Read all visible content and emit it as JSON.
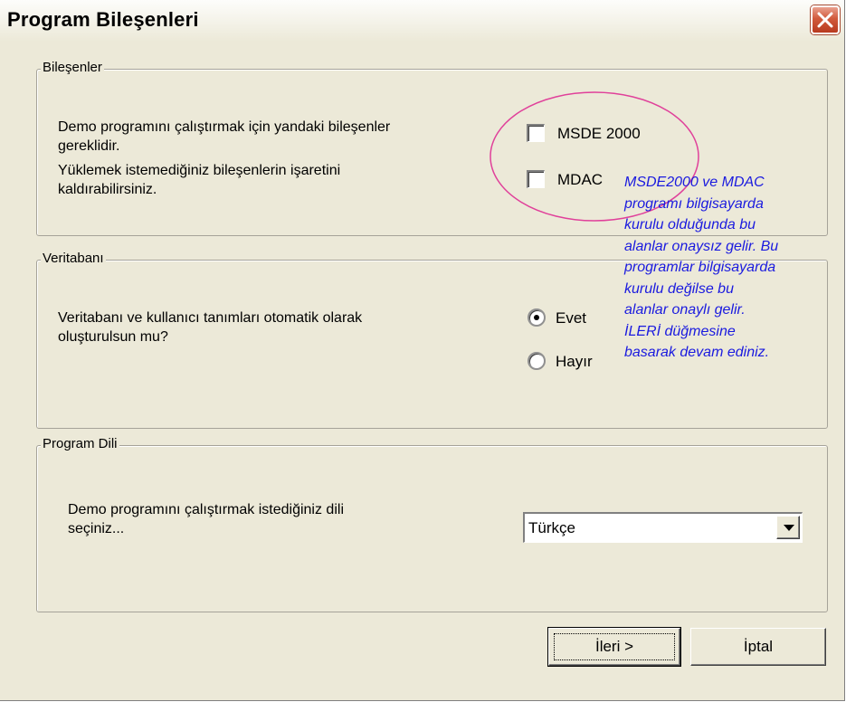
{
  "window": {
    "title": "Program Bileşenleri"
  },
  "components": {
    "legend": "Bileşenler",
    "description_line1": "Demo programını çalıştırmak için yandaki bileşenler",
    "description_line2": "gereklidir.",
    "description_line3": "Yüklemek istemediğiniz bileşenlerin işaretini",
    "description_line4": "kaldırabilirsiniz.",
    "options": [
      {
        "label": "MSDE 2000",
        "checked": false
      },
      {
        "label": "MDAC",
        "checked": false
      }
    ]
  },
  "database": {
    "legend": "Veritabanı",
    "description_line1": "Veritabanı ve kullanıcı tanımları otomatik olarak",
    "description_line2": "oluşturulsun mu?",
    "options": [
      {
        "label": "Evet",
        "selected": true
      },
      {
        "label": "Hayır",
        "selected": false
      }
    ]
  },
  "language": {
    "legend": "Program Dili",
    "description_line1": "Demo programını çalıştırmak istediğiniz dili",
    "description_line2": "seçiniz...",
    "selected": "Türkçe"
  },
  "annotation": {
    "text": "MSDE2000 ve MDAC\nprogramı bilgisayarda\nkurulu olduğunda bu\nalanlar onaysız gelir. Bu\nprogramlar bilgisayarda\nkurulu değilse bu\nalanlar onaylı gelir.\nİLERİ düğmesine\nbasarak devam ediniz.",
    "color": "#1a1adf",
    "ellipse_color": "#e0409a"
  },
  "buttons": {
    "next": "İleri >",
    "cancel": "İptal"
  },
  "icons": {
    "close": "close-icon",
    "dropdown": "chevron-down-icon"
  }
}
